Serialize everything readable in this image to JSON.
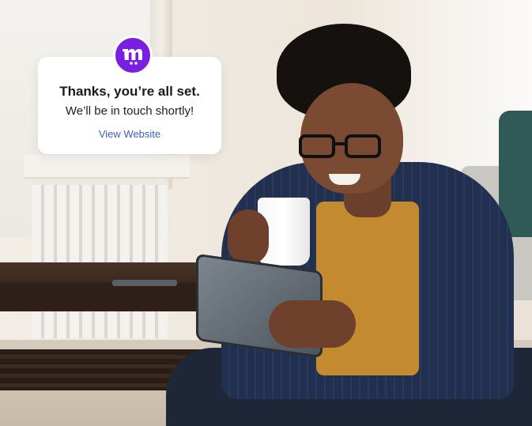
{
  "card": {
    "logo_icon": "brand-m-logo-icon",
    "title": "Thanks, you’re all set.",
    "subtitle": "We’ll be in touch shortly!",
    "link_label": "View Website"
  },
  "colors": {
    "brand": "#7a1fe0",
    "link": "#3d5fb8"
  }
}
